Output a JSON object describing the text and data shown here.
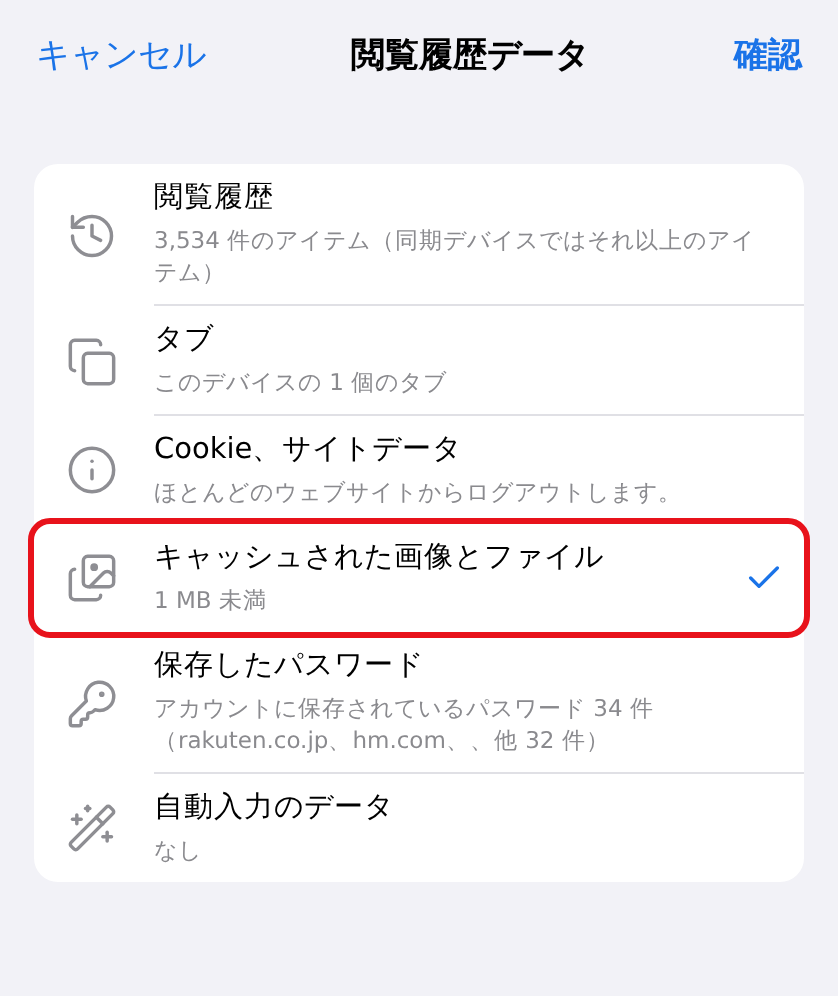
{
  "header": {
    "cancel": "キャンセル",
    "title": "閲覧履歴データ",
    "confirm": "確認"
  },
  "items": [
    {
      "kind": "history",
      "title": "閲覧履歴",
      "detail": "3,534 件のアイテム（同期デバイスではそれ以上のアイテム）",
      "checked": false,
      "highlighted": false
    },
    {
      "kind": "tabs",
      "title": "タブ",
      "detail": "このデバイスの 1 個のタブ",
      "checked": false,
      "highlighted": false
    },
    {
      "kind": "cookies",
      "title": "Cookie、サイトデータ",
      "detail": "ほとんどのウェブサイトからログアウトします。",
      "checked": false,
      "highlighted": false
    },
    {
      "kind": "cache",
      "title": "キャッシュされた画像とファイル",
      "detail": "1 MB 未満",
      "checked": true,
      "highlighted": true
    },
    {
      "kind": "passwords",
      "title": "保存したパスワード",
      "detail": "アカウントに保存されているパスワード 34 件（rakuten.co.jp、hm.com、、他 32 件）",
      "checked": false,
      "highlighted": false
    },
    {
      "kind": "autofill",
      "title": "自動入力のデータ",
      "detail": "なし",
      "checked": false,
      "highlighted": false
    }
  ]
}
